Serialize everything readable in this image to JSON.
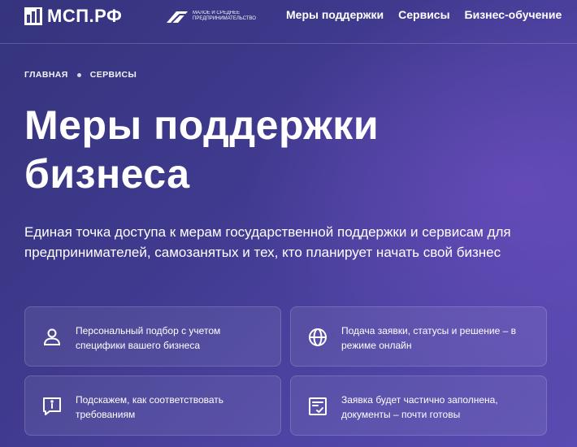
{
  "header": {
    "logo_text": "МСП.РФ",
    "partner_text": "Малое и среднее предпринимательство",
    "nav": [
      {
        "label": "Меры поддержки"
      },
      {
        "label": "Сервисы"
      },
      {
        "label": "Бизнес-обучение"
      }
    ]
  },
  "breadcrumb": [
    {
      "label": "ГЛАВНАЯ"
    },
    {
      "label": "СЕРВИСЫ"
    }
  ],
  "hero": {
    "title_line1": "Меры поддержки",
    "title_line2": "бизнеса",
    "subtitle": "Единая точка доступа к мерам государственной поддержки и сервисам для предпринимателей, самозанятых и тех, кто планирует начать свой бизнес"
  },
  "features": [
    {
      "icon": "user-icon",
      "text": "Персональный подбор с учетом специфики вашего бизнеса"
    },
    {
      "icon": "globe-icon",
      "text": "Подача заявки, статусы и решение – в режиме онлайн"
    },
    {
      "icon": "info-chat-icon",
      "text": "Подскажем, как соответствовать требованиям"
    },
    {
      "icon": "checklist-icon",
      "text": "Заявка будет частично заполнена, документы – почти готовы"
    }
  ],
  "colors": {
    "background_start": "#35347d",
    "background_end": "#5a4bb2",
    "text": "#ffffff"
  }
}
